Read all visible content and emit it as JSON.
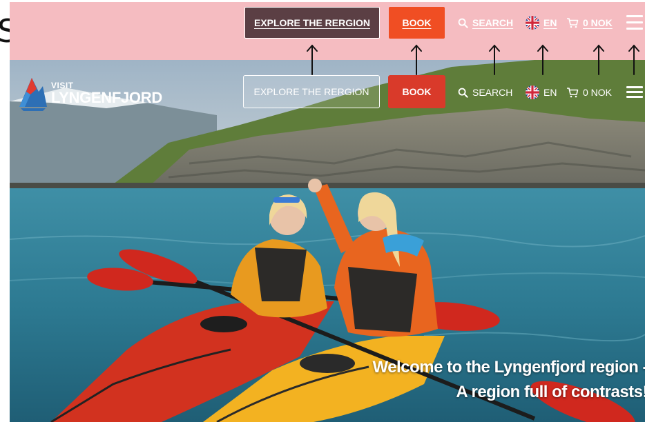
{
  "annotation": {
    "stray_text": "S"
  },
  "nav": {
    "explore_label": "EXPLORE THE RERGION",
    "book_label": "BOOK",
    "search_label": "SEARCH",
    "language_label": "EN",
    "cart_label": "0 NOK",
    "menu_icon": "hamburger-icon",
    "search_icon": "magnifier-icon",
    "language_icon": "uk-flag-icon",
    "cart_icon": "cart-icon"
  },
  "logo": {
    "line1": "VISIT",
    "line2": "LYNGENFJORD"
  },
  "hero": {
    "tagline_line1": "Welcome to the Lyngenfjord region -",
    "tagline_line2": "A region full of contrasts!"
  },
  "colors": {
    "annotation_band": "#f5bcc1",
    "book_button": "#f04e23",
    "explore_button_zoom": "#5b3f44",
    "book_button_hero": "#d93a2a"
  }
}
